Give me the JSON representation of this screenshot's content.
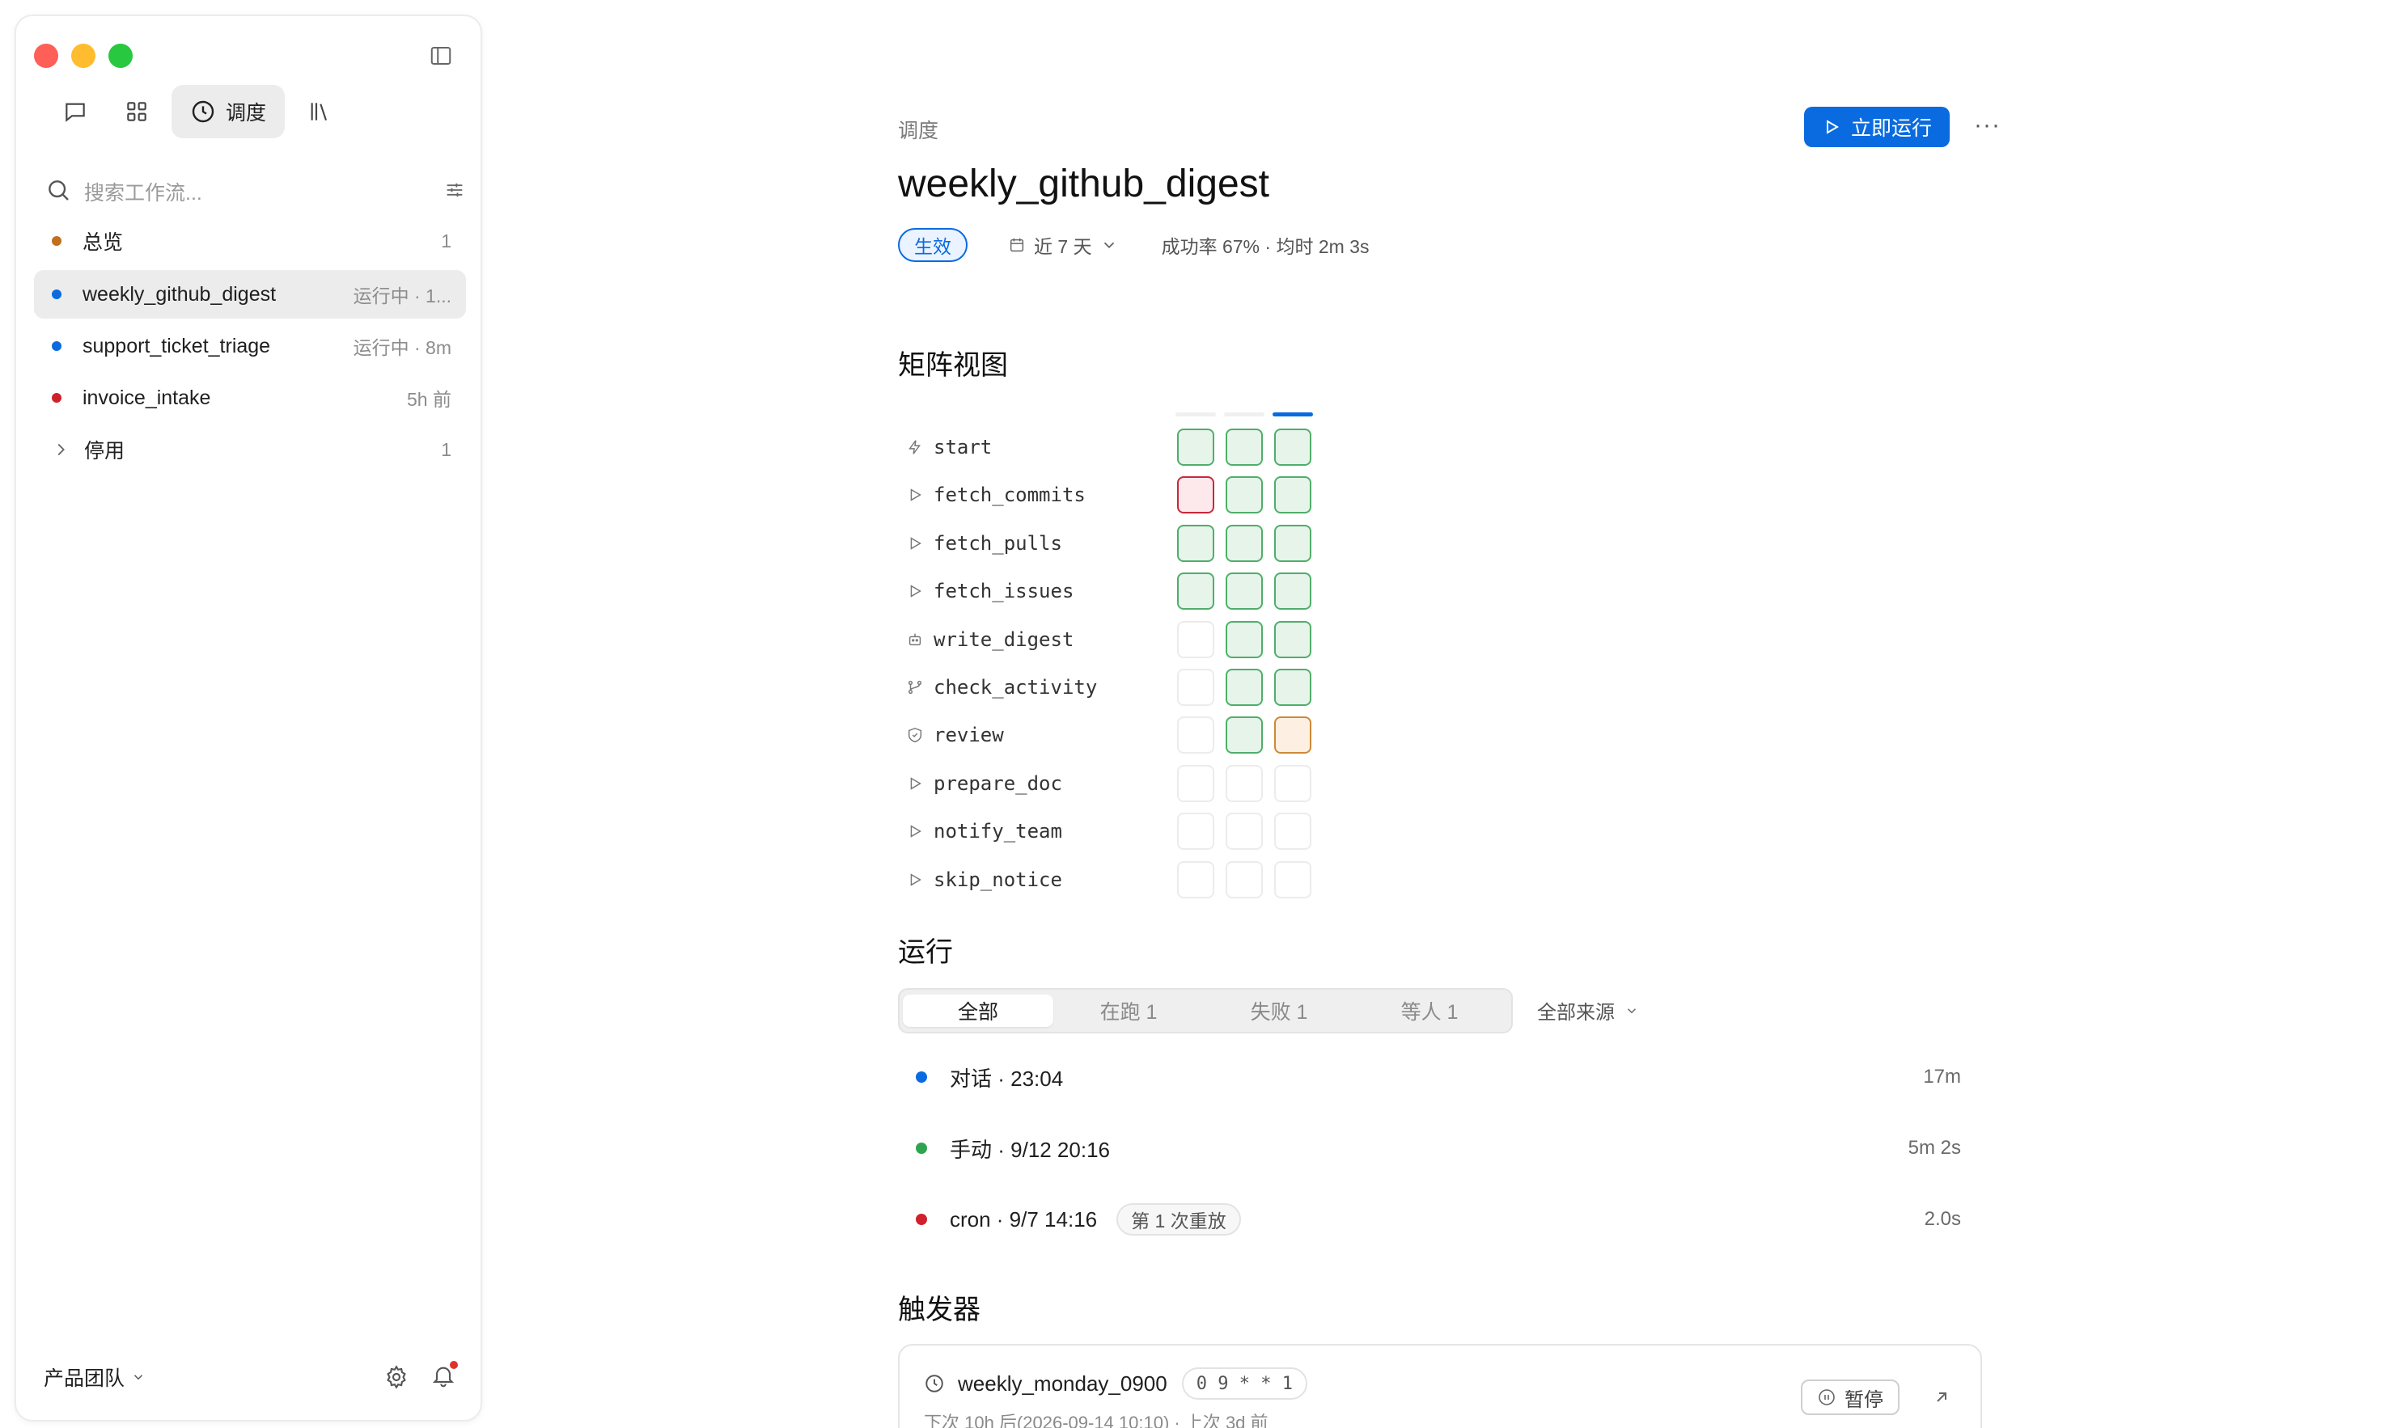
{
  "sidebar": {
    "nav": {
      "active_label": "调度"
    },
    "search": {
      "placeholder": "搜索工作流..."
    },
    "items": [
      {
        "label": "总览",
        "meta": "1",
        "dot_color": "#c0701e"
      },
      {
        "label": "weekly_github_digest",
        "meta": "运行中 · 1...",
        "dot_color": "#0a6be0"
      },
      {
        "label": "support_ticket_triage",
        "meta": "运行中 · 8m",
        "dot_color": "#0a6be0"
      },
      {
        "label": "invoice_intake",
        "meta": "5h 前",
        "dot_color": "#d0202c"
      },
      {
        "label": "停用",
        "meta": "1"
      }
    ],
    "footer": {
      "team": "产品团队"
    }
  },
  "header": {
    "breadcrumb": "调度",
    "run_now": "立即运行",
    "more": "···",
    "title": "weekly_github_digest",
    "status_badge": "生效",
    "range": "近 7 天",
    "stats": "成功率 67% · 均时 2m 3s"
  },
  "matrix": {
    "heading": "矩阵视图",
    "steps": [
      {
        "name": "start",
        "icon": "bolt-icon",
        "cells": [
          "ok",
          "ok",
          "ok"
        ]
      },
      {
        "name": "fetch_commits",
        "icon": "play-icon",
        "cells": [
          "fail",
          "ok",
          "ok"
        ]
      },
      {
        "name": "fetch_pulls",
        "icon": "play-icon",
        "cells": [
          "ok",
          "ok",
          "ok"
        ]
      },
      {
        "name": "fetch_issues",
        "icon": "play-icon",
        "cells": [
          "ok",
          "ok",
          "ok"
        ]
      },
      {
        "name": "write_digest",
        "icon": "bot-icon",
        "cells": [
          "empty",
          "ok",
          "ok"
        ]
      },
      {
        "name": "check_activity",
        "icon": "branch-icon",
        "cells": [
          "empty",
          "ok",
          "ok"
        ]
      },
      {
        "name": "review",
        "icon": "shield-check-icon",
        "cells": [
          "empty",
          "ok",
          "wait"
        ]
      },
      {
        "name": "prepare_doc",
        "icon": "play-icon",
        "cells": [
          "empty",
          "empty",
          "empty"
        ]
      },
      {
        "name": "notify_team",
        "icon": "play-icon",
        "cells": [
          "empty",
          "empty",
          "empty"
        ]
      },
      {
        "name": "skip_notice",
        "icon": "play-icon",
        "cells": [
          "empty",
          "empty",
          "empty"
        ]
      }
    ]
  },
  "runs": {
    "heading": "运行",
    "tabs": [
      "全部",
      "在跑 1",
      "失败 1",
      "等人 1"
    ],
    "source_filter": "全部来源",
    "items": [
      {
        "label": "对话 · 23:04",
        "duration": "17m",
        "dot_color": "#0a6be0",
        "tag": ""
      },
      {
        "label": "手动 · 9/12 20:16",
        "duration": "5m 2s",
        "dot_color": "#2ea44f",
        "tag": ""
      },
      {
        "label": "cron · 9/7 14:16",
        "duration": "2.0s",
        "dot_color": "#d0202c",
        "tag": "第 1 次重放"
      }
    ]
  },
  "triggers": {
    "heading": "触发器",
    "items": [
      {
        "name": "weekly_monday_0900",
        "cron": "0 9 * * 1",
        "sub": "下次 10h 后(2026-09-14 10:10) · 上次 3d 前",
        "pause": "暂停"
      }
    ]
  }
}
